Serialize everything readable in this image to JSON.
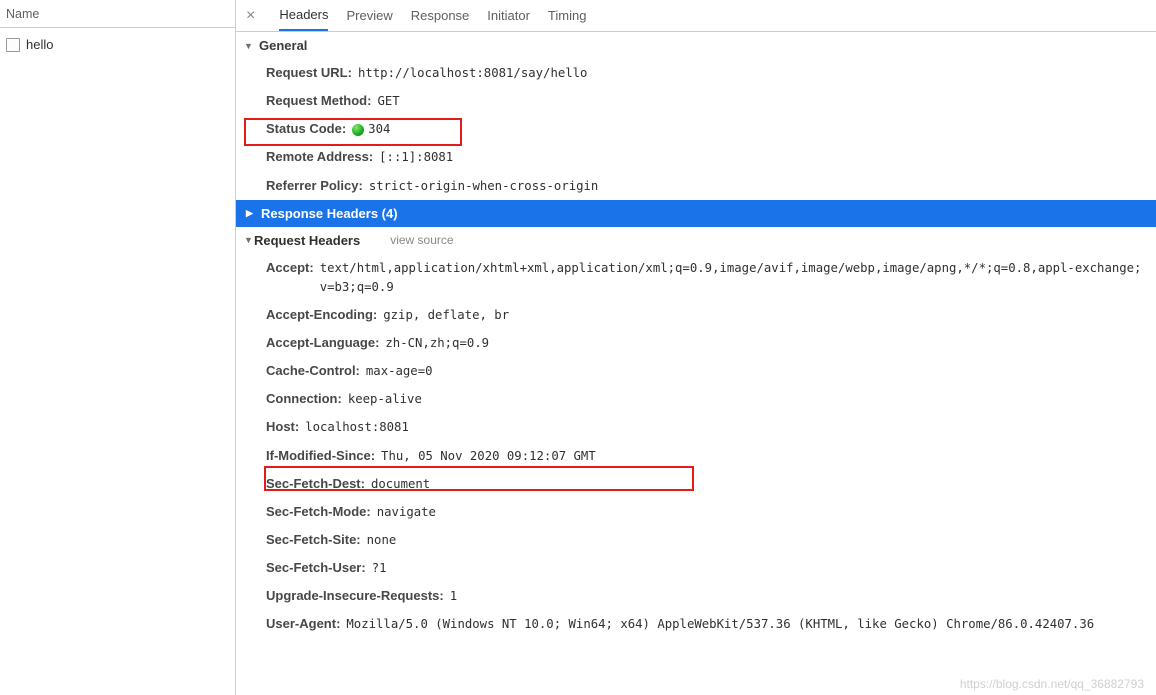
{
  "sidebar": {
    "header": "Name",
    "items": [
      {
        "label": "hello"
      }
    ]
  },
  "tabs": {
    "close_glyph": "×",
    "items": [
      "Headers",
      "Preview",
      "Response",
      "Initiator",
      "Timing"
    ],
    "active_index": 0
  },
  "sections": {
    "general": {
      "title": "General",
      "rows": [
        {
          "k": "Request URL:",
          "v": "http://localhost:8081/say/hello"
        },
        {
          "k": "Request Method:",
          "v": "GET"
        },
        {
          "k": "Status Code:",
          "v": "304",
          "status_dot": true
        },
        {
          "k": "Remote Address:",
          "v": "[::1]:8081"
        },
        {
          "k": "Referrer Policy:",
          "v": "strict-origin-when-cross-origin"
        }
      ]
    },
    "response_headers": {
      "title": "Response Headers (4)"
    },
    "request_headers": {
      "title": "Request Headers",
      "view_source_label": "view source",
      "rows": [
        {
          "k": "Accept:",
          "v": "text/html,application/xhtml+xml,application/xml;q=0.9,image/avif,image/webp,image/apng,*/*;q=0.8,appl-exchange;v=b3;q=0.9"
        },
        {
          "k": "Accept-Encoding:",
          "v": "gzip, deflate, br"
        },
        {
          "k": "Accept-Language:",
          "v": "zh-CN,zh;q=0.9"
        },
        {
          "k": "Cache-Control:",
          "v": "max-age=0"
        },
        {
          "k": "Connection:",
          "v": "keep-alive"
        },
        {
          "k": "Host:",
          "v": "localhost:8081"
        },
        {
          "k": "If-Modified-Since:",
          "v": "Thu, 05 Nov 2020 09:12:07 GMT"
        },
        {
          "k": "Sec-Fetch-Dest:",
          "v": "document"
        },
        {
          "k": "Sec-Fetch-Mode:",
          "v": "navigate"
        },
        {
          "k": "Sec-Fetch-Site:",
          "v": "none"
        },
        {
          "k": "Sec-Fetch-User:",
          "v": "?1"
        },
        {
          "k": "Upgrade-Insecure-Requests:",
          "v": "1"
        },
        {
          "k": "User-Agent:",
          "v": "Mozilla/5.0 (Windows NT 10.0; Win64; x64) AppleWebKit/537.36 (KHTML, like Gecko) Chrome/86.0.42407.36"
        }
      ]
    }
  },
  "watermark": "https://blog.csdn.net/qq_36882793"
}
